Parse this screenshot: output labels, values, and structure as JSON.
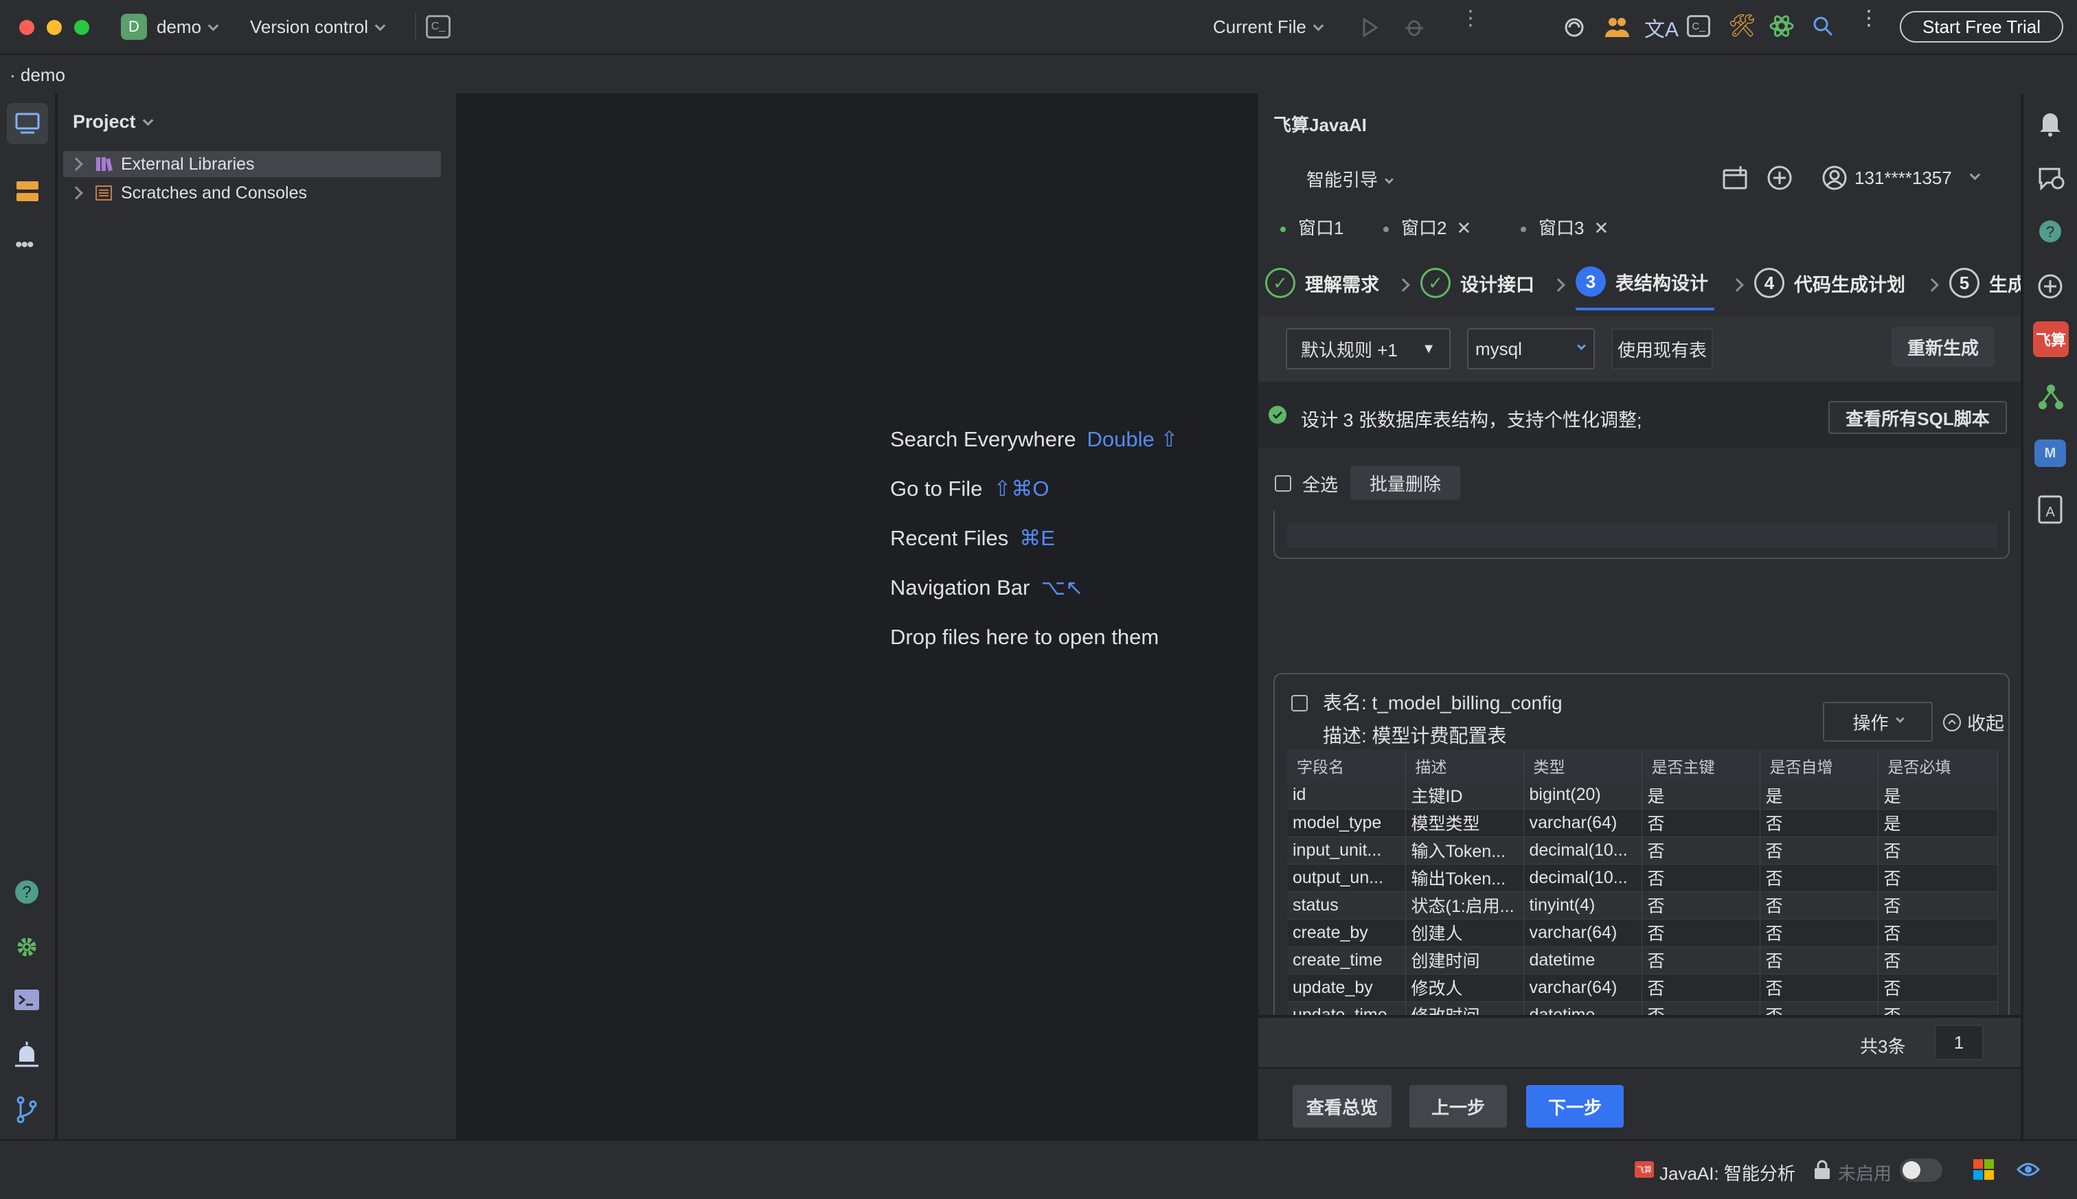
{
  "titlebar": {
    "project_letter": "D",
    "project_name": "demo",
    "vcs_label": "Version control",
    "run_config": "Current File",
    "trial_button": "Start Free Trial"
  },
  "breadcrumb": {
    "project": "demo"
  },
  "project_panel": {
    "title": "Project",
    "items": [
      {
        "label": "External Libraries",
        "icon": "library-icon"
      },
      {
        "label": "Scratches and Consoles",
        "icon": "scratches-icon"
      }
    ]
  },
  "editor_hints": [
    {
      "label": "Search Everywhere",
      "shortcut": "Double ⇧"
    },
    {
      "label": "Go to File",
      "shortcut": "⇧⌘O"
    },
    {
      "label": "Recent Files",
      "shortcut": "⌘E"
    },
    {
      "label": "Navigation Bar",
      "shortcut": "⌥↖"
    },
    {
      "label": "Drop files here to open them",
      "shortcut": ""
    }
  ],
  "ai_panel": {
    "title": "飞算JavaAI",
    "mode_label": "智能引导",
    "user": "131****1357",
    "windows": [
      {
        "label": "窗口1",
        "active": true
      },
      {
        "label": "窗口2",
        "active": false
      },
      {
        "label": "窗口3",
        "active": false
      }
    ],
    "steps": [
      {
        "num": "✓",
        "label": "理解需求",
        "state": "done"
      },
      {
        "num": "✓",
        "label": "设计接口",
        "state": "done"
      },
      {
        "num": "3",
        "label": "表结构设计",
        "state": "active"
      },
      {
        "num": "4",
        "label": "代码生成计划",
        "state": "todo"
      },
      {
        "num": "5",
        "label": "生成",
        "state": "todo"
      }
    ],
    "rules_select": "默认规则 +1",
    "db_select": "mysql",
    "use_existing_label": "使用现有表",
    "regenerate_label": "重新生成",
    "info_text": "设计 3 张数据库表结构，支持个性化调整;",
    "view_sql_label": "查看所有SQL脚本",
    "select_all_label": "全选",
    "batch_delete_label": "批量删除",
    "table_card": {
      "name": "表名: t_model_billing_config",
      "desc": "描述: 模型计费配置表",
      "ops_label": "操作",
      "collapse_label": "收起",
      "columns": [
        "字段名",
        "描述",
        "类型",
        "是否主键",
        "是否自增",
        "是否必填"
      ],
      "rows": [
        [
          "id",
          "主键ID",
          "bigint(20)",
          "是",
          "是",
          "是"
        ],
        [
          "model_type",
          "模型类型",
          "varchar(64)",
          "否",
          "否",
          "是"
        ],
        [
          "input_unit...",
          "输入Token...",
          "decimal(10...",
          "否",
          "否",
          "否"
        ],
        [
          "output_un...",
          "输出Token...",
          "decimal(10...",
          "否",
          "否",
          "否"
        ],
        [
          "status",
          "状态(1:启用...",
          "tinyint(4)",
          "否",
          "否",
          "否"
        ],
        [
          "create_by",
          "创建人",
          "varchar(64)",
          "否",
          "否",
          "否"
        ],
        [
          "create_time",
          "创建时间",
          "datetime",
          "否",
          "否",
          "否"
        ],
        [
          "update_by",
          "修改人",
          "varchar(64)",
          "否",
          "否",
          "否"
        ],
        [
          "update_time",
          "修改时间",
          "datetime",
          "否",
          "否",
          "否"
        ]
      ]
    },
    "total_label": "共3条",
    "page_value": "1",
    "overview_label": "查看总览",
    "prev_label": "上一步",
    "next_label": "下一步"
  },
  "statusbar": {
    "ai_label": "JavaAI: 智能分析",
    "disabled_label": "未启用"
  },
  "colors": {
    "accent": "#3574f0",
    "success": "#5fb865",
    "bg": "#1e1f22",
    "panel": "#2b2d30"
  }
}
